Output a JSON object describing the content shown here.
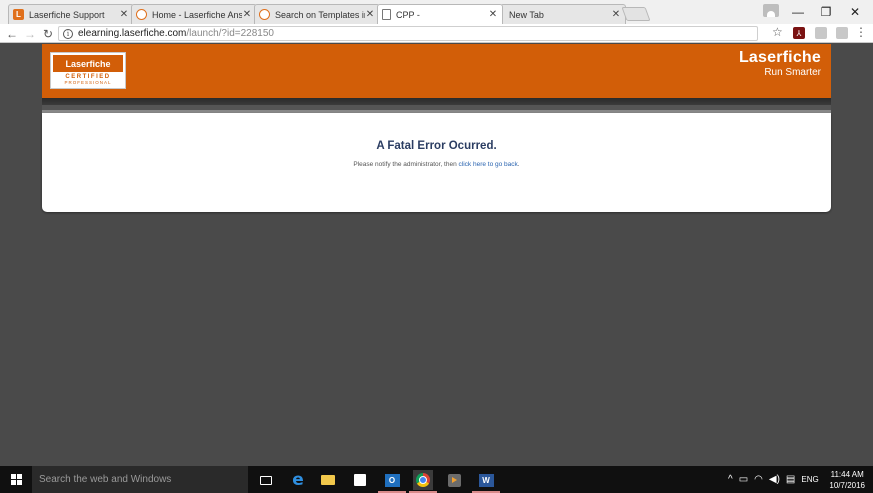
{
  "browser": {
    "tabs": [
      {
        "title": "Laserfiche Support",
        "favicon": "laserfiche-icon",
        "active": false
      },
      {
        "title": "Home - Laserfiche Answ",
        "favicon": "answers-icon",
        "active": false
      },
      {
        "title": "Search on Templates in L",
        "favicon": "answers-icon",
        "active": false
      },
      {
        "title": "CPP -",
        "favicon": "document-icon",
        "active": true
      },
      {
        "title": "New Tab",
        "favicon": "none",
        "active": false
      }
    ],
    "url_host": "elearning.laserfiche.com",
    "url_path": "/launch/?id=228150"
  },
  "page": {
    "header": {
      "badge_brand": "Laserfiche",
      "badge_certified": "CERTIFIED",
      "badge_professional": "PROFESSIONAL",
      "brand_name": "Laserfiche",
      "brand_tagline": "Run Smarter"
    },
    "error": {
      "title": "A Fatal Error Ocurred.",
      "message_prefix": "Please notify the administrator, then ",
      "link_text": "click here to go back",
      "message_suffix": "."
    },
    "colors": {
      "brand_orange": "#d25e08",
      "background": "#4a4a4a",
      "error_title": "#2b3d62",
      "link": "#2a64b0"
    }
  },
  "taskbar": {
    "search_placeholder": "Search the web and Windows",
    "language": "ENG",
    "time": "11:44 AM",
    "date": "10/7/2016"
  }
}
